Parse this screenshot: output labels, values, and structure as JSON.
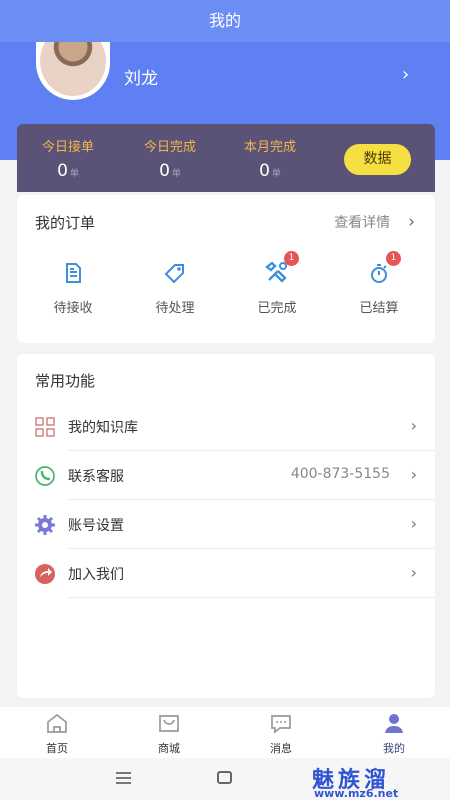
{
  "header": {
    "title": "我的"
  },
  "profile": {
    "name": "刘龙",
    "arrow": "›"
  },
  "stats": [
    {
      "label": "今日接单",
      "value": "0",
      "unit": "单"
    },
    {
      "label": "今日完成",
      "value": "0",
      "unit": "单"
    },
    {
      "label": "本月完成",
      "value": "0",
      "unit": "单"
    }
  ],
  "data_button": "数据",
  "orders": {
    "title": "我的订单",
    "detail_link": "查看详情",
    "arrow": "›",
    "items": [
      {
        "label": "待接收",
        "icon": "document-icon"
      },
      {
        "label": "待处理",
        "icon": "tag-icon"
      },
      {
        "label": "已完成",
        "icon": "tools-icon",
        "badge": "1"
      },
      {
        "label": "已结算",
        "icon": "stopwatch-icon",
        "badge": "1"
      }
    ]
  },
  "features": {
    "title": "常用功能",
    "items": [
      {
        "label": "我的知识库",
        "value": "",
        "icon": "grid-icon",
        "color": "#d98a86"
      },
      {
        "label": "联系客服",
        "value": "400-873-5155",
        "icon": "phone-icon",
        "color": "#47b36f"
      },
      {
        "label": "账号设置",
        "value": "",
        "icon": "gear-icon",
        "color": "#7b78d6"
      },
      {
        "label": "加入我们",
        "value": "",
        "icon": "share-icon",
        "color": "#d9615d"
      }
    ],
    "arrow": "›"
  },
  "tabs": [
    {
      "label": "首页",
      "icon": "home-icon"
    },
    {
      "label": "商城",
      "icon": "mall-icon"
    },
    {
      "label": "消息",
      "icon": "message-icon"
    },
    {
      "label": "我的",
      "icon": "user-icon",
      "active": true
    }
  ],
  "watermark": {
    "text": "魅族溜",
    "url": "www.mz6.net"
  },
  "colors": {
    "primary": "#5f80f2",
    "stats_bg": "#5b5377",
    "accent": "#f6df43",
    "badge": "#e65555",
    "icon_blue": "#3d8fd9"
  }
}
